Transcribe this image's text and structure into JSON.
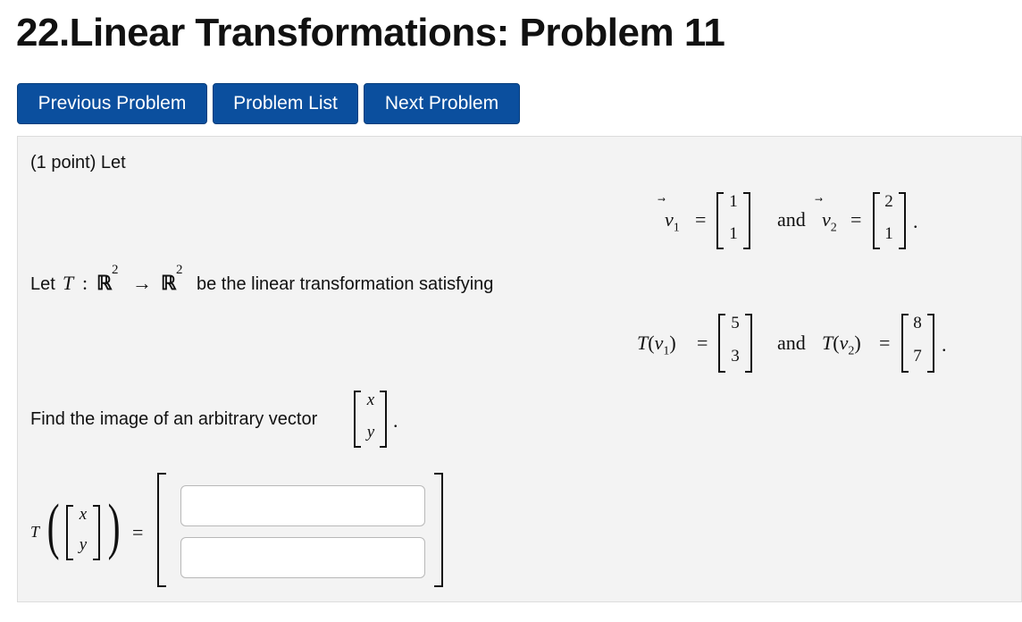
{
  "page": {
    "title": "22.Linear Transformations: Problem 11"
  },
  "nav": {
    "previous_label": "Previous Problem",
    "list_label": "Problem List",
    "next_label": "Next Problem"
  },
  "problem": {
    "intro": "(1 point) Let",
    "let_text": "Let",
    "colon": ":",
    "domain": "ℝ",
    "codomain": "ℝ",
    "exponent": "2",
    "arrow": "→",
    "satisfying_text": "be the linear transformation satisfying",
    "find_text": "Find the image of an arbitrary vector",
    "and": "and",
    "period": ".",
    "equals": "=",
    "T": "T",
    "v1_label": "v",
    "v1_sub": "1",
    "v2_label": "v",
    "v2_sub": "2",
    "vector_arrow": "⃗",
    "v1": [
      "1",
      "1"
    ],
    "v2": [
      "2",
      "1"
    ],
    "Tv1": [
      "5",
      "3"
    ],
    "Tv2": [
      "8",
      "7"
    ],
    "arbitrary": [
      "x",
      "y"
    ]
  },
  "answer": {
    "row1_value": "",
    "row2_value": ""
  },
  "colors": {
    "button_bg": "#0b4f9e",
    "panel_bg": "#f3f3f3"
  }
}
